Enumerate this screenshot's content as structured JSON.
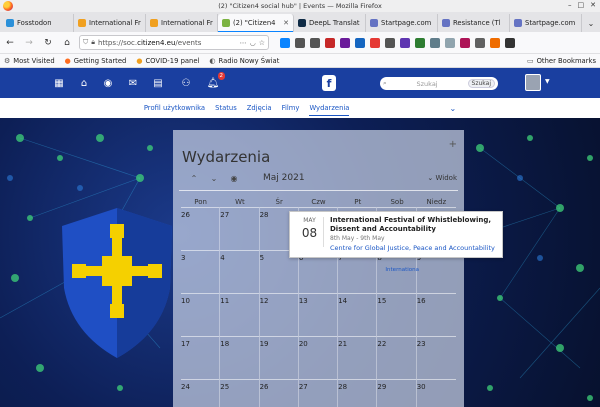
{
  "window": {
    "title": "(2) \"Citizen4 social hub\" | Events — Mozilla Firefox",
    "minimize": "–",
    "maximize": "□",
    "close": "✕"
  },
  "tabs": [
    {
      "label": "Fosstodon",
      "color": "#2b90d9",
      "active": false
    },
    {
      "label": "International Fr",
      "color": "#f0a020",
      "active": false
    },
    {
      "label": "International Fr",
      "color": "#f0a020",
      "active": false
    },
    {
      "label": "(2) \"Citizen4",
      "color": "#7cb342",
      "active": true
    },
    {
      "label": "DeepL Translat",
      "color": "#0f2b46",
      "active": false
    },
    {
      "label": "Startpage.com",
      "color": "#6573c3",
      "active": false
    },
    {
      "label": "Resistance (Tl",
      "color": "#6573c3",
      "active": false
    },
    {
      "label": "Startpage.com",
      "color": "#6573c3",
      "active": false
    }
  ],
  "tabs_more": "⌄",
  "nav": {
    "url_host": "https://soc.",
    "url_domain": "citizen4.eu",
    "url_path": "/events"
  },
  "extensions": [
    {
      "name": "download-icon",
      "color": "#0a84ff"
    },
    {
      "name": "library-icon",
      "color": "#555555"
    },
    {
      "name": "sidebar-icon",
      "color": "#555555"
    },
    {
      "name": "ublock-icon",
      "color": "#c62828"
    },
    {
      "name": "vpn-icon",
      "color": "#6a1b9a"
    },
    {
      "name": "ext-blue-icon",
      "color": "#1565c0"
    },
    {
      "name": "ext-red-icon",
      "color": "#e53935"
    },
    {
      "name": "pencil-icon",
      "color": "#555555"
    },
    {
      "name": "ext-purple-icon",
      "color": "#5e35b1"
    },
    {
      "name": "ext-green-icon",
      "color": "#2e7d32"
    },
    {
      "name": "ext-gray-icon",
      "color": "#607d8b"
    },
    {
      "name": "ext-gray2-icon",
      "color": "#90a4ae"
    },
    {
      "name": "ext-pink-icon",
      "color": "#ad1457"
    },
    {
      "name": "ext-slash-icon",
      "color": "#616161"
    },
    {
      "name": "ext-orange-icon",
      "color": "#ef6c00"
    },
    {
      "name": "menu-icon",
      "color": "#333333"
    }
  ],
  "bookmarks": {
    "items": [
      "Most Visited",
      "Getting Started",
      "COVID-19 panel",
      "Radio Nowy Świat"
    ],
    "other": "Other Bookmarks"
  },
  "site": {
    "brand": "f",
    "notifications_count": "2",
    "search_placeholder": "Szukaj",
    "search_button": "Szukaj"
  },
  "subnav": {
    "items": [
      "Profil użytkownika",
      "Status",
      "Zdjęcia",
      "Filmy",
      "Wydarzenia"
    ],
    "active": "Wydarzenia"
  },
  "calendar": {
    "title": "Wydarzenia",
    "add": "+",
    "month": "Maj 2021",
    "view_label": "Widok",
    "weekdays": [
      "Pon",
      "Wt",
      "Śr",
      "Czw",
      "Pt",
      "Sob",
      "Niedz"
    ],
    "days": [
      "26",
      "27",
      "28",
      "29",
      "30",
      "1",
      "2",
      "3",
      "4",
      "5",
      "6",
      "7",
      "8",
      "9",
      "10",
      "11",
      "12",
      "13",
      "14",
      "15",
      "16",
      "17",
      "18",
      "19",
      "20",
      "21",
      "22",
      "23",
      "24",
      "25",
      "26",
      "27",
      "28",
      "29",
      "30"
    ],
    "event_chip": "Internationa"
  },
  "popup": {
    "month": "MAY",
    "day": "08",
    "title": "International Festival of Whistleblowing, Dissent and Accountability",
    "dates": "8th May - 9th May",
    "organizer": "Centre for Global Justice, Peace and Accountability"
  }
}
